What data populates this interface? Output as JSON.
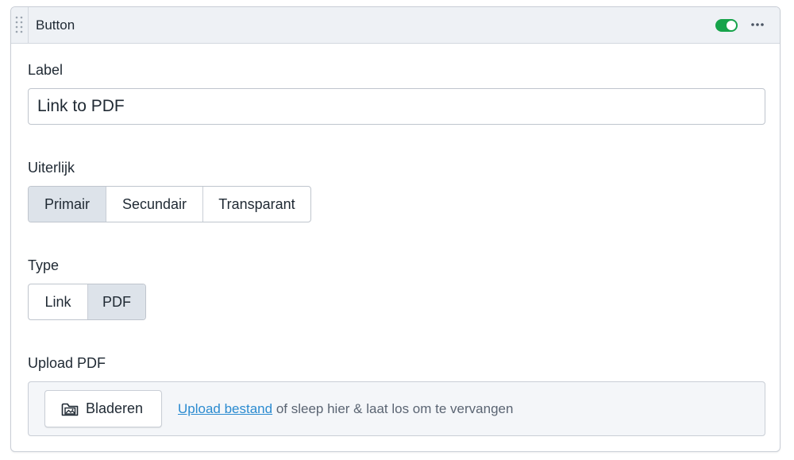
{
  "block": {
    "title": "Button",
    "enabled": true,
    "toggle_color": "#16a34a",
    "header_icons": [
      "drag-handle-icon",
      "more-icon"
    ]
  },
  "label_field": {
    "label": "Label",
    "value": "Link to PDF"
  },
  "appearance": {
    "label": "Uiterlijk",
    "options": [
      "Primair",
      "Secundair",
      "Transparant"
    ],
    "selected": "Primair"
  },
  "type": {
    "label": "Type",
    "options": [
      "Link",
      "PDF"
    ],
    "selected": "PDF"
  },
  "upload": {
    "label": "Upload PDF",
    "browse_label": "Bladeren",
    "browse_icon": "folder-image-icon",
    "link_text": "Upload bestand",
    "hint_text": "of sleep hier & laat los om te vervangen",
    "link_color": "#2b8bd0"
  }
}
